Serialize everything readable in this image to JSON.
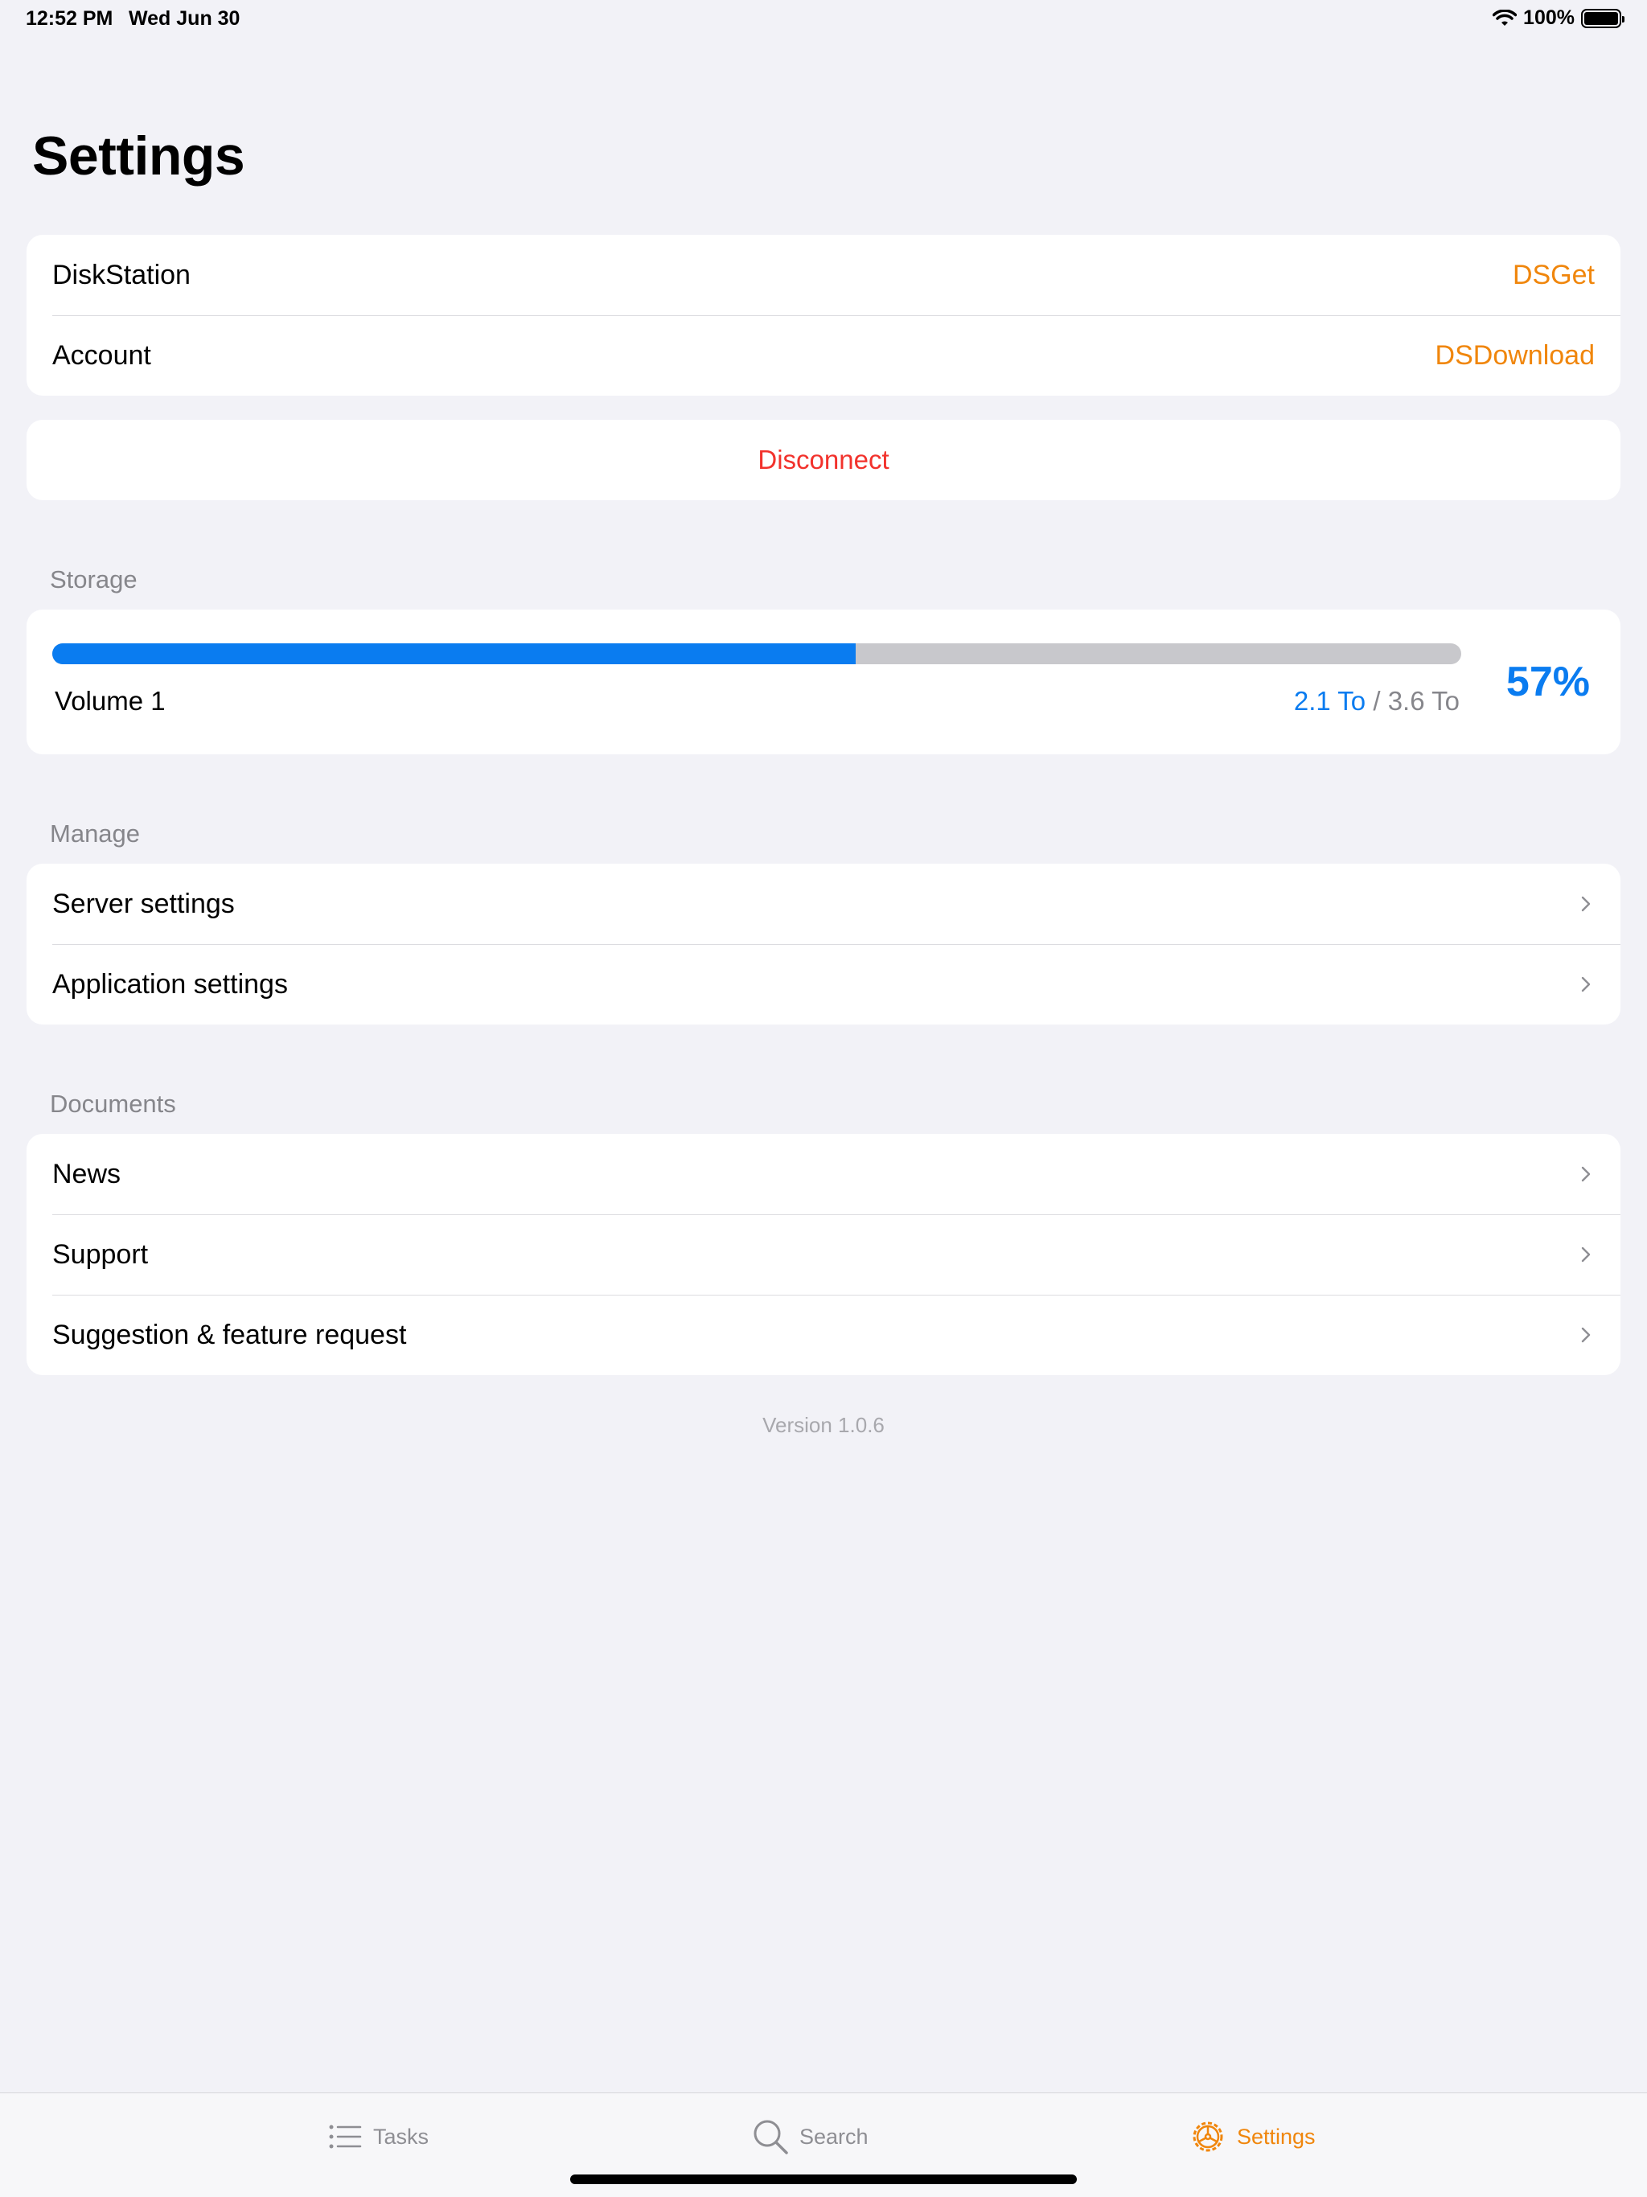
{
  "status_bar": {
    "time": "12:52 PM",
    "date": "Wed Jun 30",
    "battery": "100%"
  },
  "title": "Settings",
  "connection": {
    "items": [
      {
        "label": "DiskStation",
        "value": "DSGet"
      },
      {
        "label": "Account",
        "value": "DSDownload"
      }
    ]
  },
  "disconnect_label": "Disconnect",
  "storage": {
    "header": "Storage",
    "volume": {
      "name": "Volume 1",
      "used": "2.1 To",
      "separator": " / ",
      "total": "3.6 To",
      "percent_label": "57%",
      "fraction": 0.57
    }
  },
  "manage": {
    "header": "Manage",
    "items": [
      {
        "label": "Server settings"
      },
      {
        "label": "Application settings"
      }
    ]
  },
  "documents": {
    "header": "Documents",
    "items": [
      {
        "label": "News"
      },
      {
        "label": "Support"
      },
      {
        "label": "Suggestion & feature request"
      }
    ]
  },
  "version": "Version 1.0.6",
  "tabs": [
    {
      "label": "Tasks",
      "icon": "list-icon"
    },
    {
      "label": "Search",
      "icon": "search-icon"
    },
    {
      "label": "Settings",
      "icon": "gear-icon",
      "active": true
    }
  ],
  "colors": {
    "accent": "#f0860c",
    "blue": "#0a7cf0",
    "destructive": "#f2322c"
  }
}
